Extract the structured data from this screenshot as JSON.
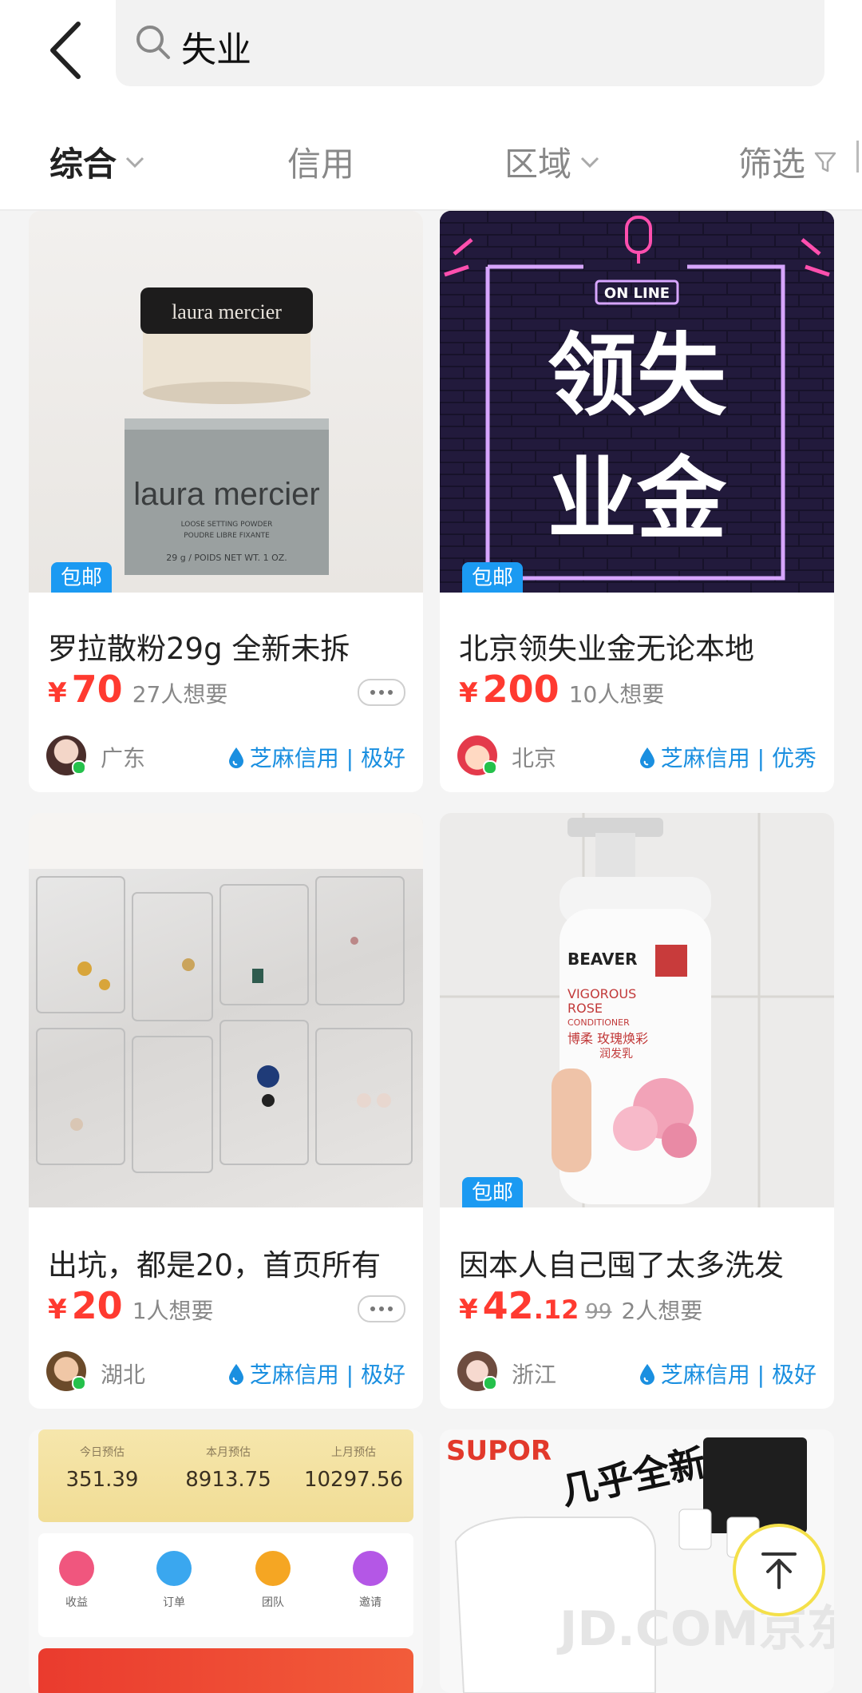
{
  "search": {
    "query": "失业"
  },
  "tabs": [
    {
      "label": "综合"
    },
    {
      "label": "信用"
    },
    {
      "label": "区域"
    },
    {
      "label": "筛选"
    }
  ],
  "products": [
    {
      "title": "罗拉散粉29g  全新未拆",
      "price_int": "70",
      "price_dec": "",
      "price_orig": "",
      "want": "27人想要",
      "badge": "包邮",
      "location": "广东",
      "credit": "芝麻信用 | 极好",
      "image_text": {
        "brand": "laura mercier",
        "sub1": "LOOSE SETTING POWDER",
        "sub2": "POUDRE LIBRE FIXANTE",
        "sub3": "29 g / POIDS NET WT. 1 OZ."
      }
    },
    {
      "title": "北京领失业金无论本地",
      "price_int": "200",
      "price_dec": "",
      "price_orig": "",
      "want": "10人想要",
      "badge": "包邮",
      "location": "北京",
      "credit": "芝麻信用 | 优秀",
      "image_text": {
        "tag": "ON LINE",
        "big1": "领失",
        "big2": "业金"
      }
    },
    {
      "title": "出坑，都是20，首页所有",
      "price_int": "20",
      "price_dec": "",
      "price_orig": "",
      "want": "1人想要",
      "badge": "",
      "location": "湖北",
      "credit": "芝麻信用 | 极好"
    },
    {
      "title": "因本人自己囤了太多洗发",
      "price_int": "42",
      "price_dec": ".12",
      "price_orig": "99",
      "want": "2人想要",
      "badge": "包邮",
      "location": "浙江",
      "credit": "芝麻信用 | 极好",
      "image_text": {
        "brand": "BEAVER",
        "l1": "VIGOROUS",
        "l2": "ROSE",
        "l3": "CONDITIONER",
        "cn": "博柔 玫瑰焕彩",
        "cn2": "润发乳"
      }
    }
  ],
  "promo": {
    "stats": [
      {
        "label": "今日预估",
        "value": "351.39"
      },
      {
        "label": "本月预估",
        "value": "8913.75"
      },
      {
        "label": "上月预估",
        "value": "10297.56"
      }
    ],
    "icons": [
      {
        "label": "收益",
        "color": "#f0567e"
      },
      {
        "label": "订单",
        "color": "#3aa7ef"
      },
      {
        "label": "团队",
        "color": "#f5a623"
      },
      {
        "label": "邀请",
        "color": "#b457e6"
      }
    ]
  },
  "card6": {
    "brand": "SUPOR",
    "sticker": "几乎全新",
    "watermark": "JD.COM京东"
  },
  "colors": {
    "accent_red": "#ff3a30",
    "credit_blue": "#1a8fe0",
    "badge_blue": "#1b9af2"
  }
}
